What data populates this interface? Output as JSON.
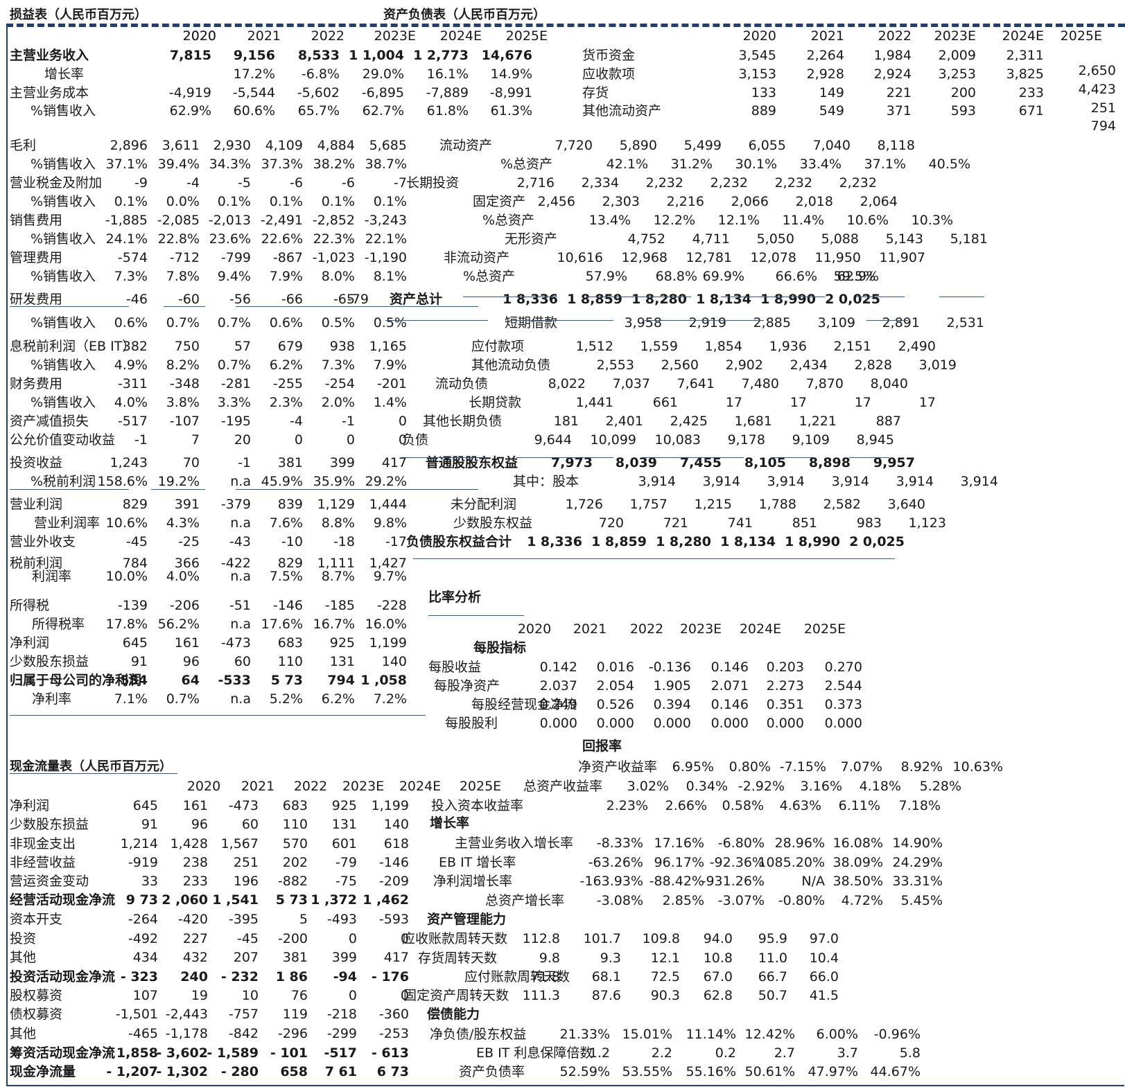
{
  "is": {
    "title": "损益表（人民币百万元）",
    "years": [
      "2020",
      "2021",
      "2022",
      "2023E",
      "2024E",
      "2025E"
    ],
    "rows": [
      {
        "label": "主营业务收入",
        "bold": true,
        "values": [
          "7,815",
          "9,156",
          "8,533",
          "1 1,004",
          "1 2,773",
          "14,676"
        ]
      },
      {
        "label": "增长率",
        "values": [
          "",
          "17.2%",
          "-6.8%",
          "29.0%",
          "16.1%",
          "14.9%"
        ]
      },
      {
        "label": "主营业务成本",
        "values": [
          "-4,919",
          "-5,544",
          "-5,602",
          "-6,895",
          "-7,889",
          "-8,991"
        ]
      },
      {
        "label": "%销售收入",
        "values": [
          "62.9%",
          "60.6%",
          "65.7%",
          "62.7%",
          "61.8%",
          "61.3%"
        ]
      },
      {
        "label": "毛利",
        "values": [
          "2,896",
          "3,611",
          "2,930",
          "4,109",
          "4,884",
          "5,685"
        ]
      },
      {
        "label": "%销售收入",
        "values": [
          "37.1%",
          "39.4%",
          "34.3%",
          "37.3%",
          "38.2%",
          "38.7%"
        ]
      },
      {
        "label": "营业税金及附加",
        "values": [
          "-9",
          "-4",
          "-5",
          "-6",
          "-6",
          "-7"
        ]
      },
      {
        "label": "%销售收入",
        "values": [
          "0.1%",
          "0.0%",
          "0.1%",
          "0.1%",
          "0.1%",
          "0.1%"
        ]
      },
      {
        "label": "销售费用",
        "values": [
          "-1,885",
          "-2,085",
          "-2,013",
          "-2,491",
          "-2,852",
          "-3,243"
        ]
      },
      {
        "label": "%销售收入",
        "values": [
          "24.1%",
          "22.8%",
          "23.6%",
          "22.6%",
          "22.3%",
          "22.1%"
        ]
      },
      {
        "label": "管理费用",
        "values": [
          "-574",
          "-712",
          "-799",
          "-867",
          "-1,023",
          "-1,190"
        ]
      },
      {
        "label": "%销售收入",
        "values": [
          "7.3%",
          "7.8%",
          "9.4%",
          "7.9%",
          "8.0%",
          "8.1%"
        ]
      },
      {
        "label": "研发费用",
        "values": [
          "-46",
          "-60",
          "-56",
          "-66",
          "-65",
          "-79"
        ]
      },
      {
        "label": "%销售收入",
        "values": [
          "0.6%",
          "0.7%",
          "0.7%",
          "0.6%",
          "0.5%",
          "0.5%"
        ]
      },
      {
        "label": "息税前利润（EB IT）",
        "values": [
          "382",
          "750",
          "57",
          "679",
          "938",
          "1,165"
        ]
      },
      {
        "label": "%销售收入",
        "values": [
          "4.9%",
          "8.2%",
          "0.7%",
          "6.2%",
          "7.3%",
          "7.9%"
        ]
      },
      {
        "label": "财务费用",
        "values": [
          "-311",
          "-348",
          "-281",
          "-255",
          "-254",
          "-201"
        ]
      },
      {
        "label": "%销售收入",
        "values": [
          "4.0%",
          "3.8%",
          "3.3%",
          "2.3%",
          "2.0%",
          "1.4%"
        ]
      },
      {
        "label": "资产减值损失",
        "values": [
          "-517",
          "-107",
          "-195",
          "-4",
          "-1",
          "0"
        ]
      },
      {
        "label": "公允价值变动收益",
        "values": [
          "-1",
          "7",
          "20",
          "0",
          "0",
          "0"
        ]
      },
      {
        "label": "投资收益",
        "values": [
          "1,243",
          "70",
          "-1",
          "381",
          "399",
          "417"
        ]
      },
      {
        "label": "%税前利润",
        "values": [
          "158.6%",
          "19.2%",
          "n.a",
          "45.9%",
          "35.9%",
          "29.2%"
        ]
      },
      {
        "label": "营业利润",
        "values": [
          "829",
          "391",
          "-379",
          "839",
          "1,129",
          "1,444"
        ]
      },
      {
        "label": "营业利润率",
        "values": [
          "10.6%",
          "4.3%",
          "n.a",
          "7.6%",
          "8.8%",
          "9.8%"
        ]
      },
      {
        "label": "营业外收支",
        "values": [
          "-45",
          "-25",
          "-43",
          "-10",
          "-18",
          "-17"
        ]
      },
      {
        "label": "税前利润",
        "values": [
          "784",
          "366",
          "-422",
          "829",
          "1,111",
          "1,427"
        ]
      },
      {
        "label": "利润率",
        "values": [
          "10.0%",
          "4.0%",
          "n.a",
          "7.5%",
          "8.7%",
          "9.7%"
        ]
      },
      {
        "label": "所得税",
        "values": [
          "-139",
          "-206",
          "-51",
          "-146",
          "-185",
          "-228"
        ]
      },
      {
        "label": "所得税率",
        "values": [
          "17.8%",
          "56.2%",
          "n.a",
          "17.6%",
          "16.7%",
          "16.0%"
        ]
      },
      {
        "label": "净利润",
        "values": [
          "645",
          "161",
          "-473",
          "683",
          "925",
          "1,199"
        ]
      },
      {
        "label": "少数股东损益",
        "values": [
          "91",
          "96",
          "60",
          "110",
          "131",
          "140"
        ]
      },
      {
        "label": "归属于母公司的净利润",
        "bold": true,
        "values": [
          "554",
          "64",
          "-533",
          "5 73",
          "794",
          "1 ,058"
        ]
      },
      {
        "label": "净利率",
        "values": [
          "7.1%",
          "0.7%",
          "n.a",
          "5.2%",
          "6.2%",
          "7.2%"
        ]
      }
    ]
  },
  "bs": {
    "title": "资产负债表（人民币百万元）",
    "years": [
      "2020",
      "2021",
      "2022",
      "2023E",
      "2024E",
      "2025E"
    ],
    "rows": [
      {
        "label": "货币资金",
        "values": [
          "3,545",
          "2,264",
          "1,984",
          "2,009",
          "2,311",
          "2,650"
        ]
      },
      {
        "label": "应收款项",
        "values": [
          "3,153",
          "2,928",
          "2,924",
          "3,253",
          "3,825",
          "4,423"
        ]
      },
      {
        "label": "存货",
        "values": [
          "133",
          "149",
          "221",
          "200",
          "233",
          "251"
        ]
      },
      {
        "label": "其他流动资产",
        "values": [
          "889",
          "549",
          "371",
          "593",
          "671",
          "794"
        ]
      },
      {
        "label": "流动资产",
        "values": [
          "7,720",
          "5,890",
          "5,499",
          "6,055",
          "7,040",
          "8,118"
        ]
      },
      {
        "label": "%总资产",
        "values": [
          "42.1%",
          "31.2%",
          "30.1%",
          "33.4%",
          "37.1%",
          "40.5%"
        ]
      },
      {
        "label": "长期投资",
        "values": [
          "2,716",
          "2,334",
          "2,232",
          "2,232",
          "2,232",
          "2,232"
        ]
      },
      {
        "label": "固定资产",
        "values": [
          "2,456",
          "2,303",
          "2,216",
          "2,066",
          "2,018",
          "2,064"
        ]
      },
      {
        "label": "%总资产",
        "values": [
          "13.4%",
          "12.2%",
          "12.1%",
          "11.4%",
          "10.6%",
          "10.3%"
        ]
      },
      {
        "label": "无形资产",
        "values": [
          "4,752",
          "4,711",
          "5,050",
          "5,088",
          "5,143",
          "5,181"
        ]
      },
      {
        "label": "非流动资产",
        "values": [
          "10,616",
          "12,968",
          "12,781",
          "12,078",
          "11,950",
          "11,907"
        ]
      },
      {
        "label": "%总资产",
        "values": [
          "57.9%",
          "68.8%",
          "69.9%",
          "66.6%",
          "62.9%",
          "59.5%"
        ]
      },
      {
        "label": "资产总计",
        "bold": true,
        "values": [
          "1 8,336",
          "1 8,859",
          "1 8,280",
          "1 8,134",
          "1 8,990",
          "2 0,025"
        ]
      },
      {
        "label": "短期借款",
        "values": [
          "3,958",
          "2,919",
          "2,885",
          "3,109",
          "2,891",
          "2,531"
        ]
      },
      {
        "label": "应付款项",
        "values": [
          "1,512",
          "1,559",
          "1,854",
          "1,936",
          "2,151",
          "2,490"
        ]
      },
      {
        "label": "其他流动负债",
        "values": [
          "2,553",
          "2,560",
          "2,902",
          "2,434",
          "2,828",
          "3,019"
        ]
      },
      {
        "label": "流动负债",
        "values": [
          "8,022",
          "7,037",
          "7,641",
          "7,480",
          "7,870",
          "8,040"
        ]
      },
      {
        "label": "长期贷款",
        "values": [
          "1,441",
          "661",
          "17",
          "17",
          "17",
          "17"
        ]
      },
      {
        "label": "其他长期负债",
        "values": [
          "181",
          "2,401",
          "2,425",
          "1,681",
          "1,221",
          "887"
        ]
      },
      {
        "label": "负债",
        "values": [
          "9,644",
          "10,099",
          "10,083",
          "9,178",
          "9,109",
          "8,945"
        ]
      },
      {
        "label": "普通股股东权益",
        "bold": true,
        "values": [
          "7,973",
          "8,039",
          "7,455",
          "8,105",
          "8,898",
          "9,957"
        ]
      },
      {
        "label": "其中：股本",
        "values": [
          "3,914",
          "3,914",
          "3,914",
          "3,914",
          "3,914",
          "3,914"
        ]
      },
      {
        "label": "未分配利润",
        "values": [
          "1,726",
          "1,757",
          "1,215",
          "1,788",
          "2,582",
          "3,640"
        ]
      },
      {
        "label": "少数股东权益",
        "values": [
          "720",
          "721",
          "741",
          "851",
          "983",
          "1,123"
        ]
      },
      {
        "label": "负债股东权益合计",
        "bold": true,
        "values": [
          "1 8,336",
          "1 8,859",
          "1 8,280",
          "1 8,134",
          "1 8,990",
          "2 0,025"
        ]
      }
    ]
  },
  "ratio": {
    "title": "比率分析",
    "years": [
      "2020",
      "2021",
      "2022",
      "2023E",
      "2024E",
      "2025E"
    ],
    "sections": [
      {
        "title": "每股指标",
        "rows": [
          {
            "label": "每股收益",
            "values": [
              "0.142",
              "0.016",
              "-0.136",
              "0.146",
              "0.203",
              "0.270"
            ]
          },
          {
            "label": "每股净资产",
            "values": [
              "2.037",
              "2.054",
              "1.905",
              "2.071",
              "2.273",
              "2.544"
            ]
          },
          {
            "label": "每股经营现金净流",
            "values": [
              "0.249",
              "0.526",
              "0.394",
              "0.146",
              "0.351",
              "0.373"
            ]
          },
          {
            "label": "每股股利",
            "values": [
              "0.000",
              "0.000",
              "0.000",
              "0.000",
              "0.000",
              "0.000"
            ]
          }
        ]
      },
      {
        "title": "回报率",
        "rows": [
          {
            "label": "净资产收益率",
            "values": [
              "6.95%",
              "0.80%",
              "-7.15%",
              "7.07%",
              "8.92%",
              "10.63%"
            ]
          },
          {
            "label": "总资产收益率",
            "values": [
              "3.02%",
              "0.34%",
              "-2.92%",
              "3.16%",
              "4.18%",
              "5.28%"
            ]
          },
          {
            "label": "投入资本收益率",
            "values": [
              "2.23%",
              "2.66%",
              "0.58%",
              "4.63%",
              "6.11%",
              "7.18%"
            ]
          }
        ]
      },
      {
        "title": "增长率",
        "rows": [
          {
            "label": "主营业务收入增长率",
            "values": [
              "-8.33%",
              "17.16%",
              "-6.80%",
              "28.96%",
              "16.08%",
              "14.90%"
            ]
          },
          {
            "label": "EB IT 增长率",
            "values": [
              "-63.26%",
              "96.17%",
              "-92.36%",
              "1085.20%",
              "38.09%",
              "24.29%"
            ]
          },
          {
            "label": "净利润增长率",
            "values": [
              "-163.93%",
              "-88.42%",
              "-931.26%",
              "N/A",
              "38.50%",
              "33.31%"
            ]
          },
          {
            "label": "总资产增长率",
            "values": [
              "-3.08%",
              "2.85%",
              "-3.07%",
              "-0.80%",
              "4.72%",
              "5.45%"
            ]
          }
        ]
      },
      {
        "title": "资产管理能力",
        "rows": [
          {
            "label": "应收账款周转天数",
            "values": [
              "112.8",
              "101.7",
              "109.8",
              "94.0",
              "95.9",
              "97.0"
            ]
          },
          {
            "label": "存货周转天数",
            "values": [
              "9.8",
              "9.3",
              "12.1",
              "10.8",
              "11.0",
              "10.4"
            ]
          },
          {
            "label": "应付账款周转天数",
            "values": [
              "71.8",
              "68.1",
              "72.5",
              "67.0",
              "66.7",
              "66.0"
            ]
          },
          {
            "label": "固定资产周转天数",
            "values": [
              "111.3",
              "87.6",
              "90.3",
              "62.8",
              "50.7",
              "41.5"
            ]
          }
        ]
      },
      {
        "title": "偿债能力",
        "rows": [
          {
            "label": "净负债/股东权益",
            "values": [
              "21.33%",
              "15.01%",
              "11.14%",
              "12.42%",
              "6.00%",
              "-0.96%"
            ]
          },
          {
            "label": "EB IT 利息保障倍数",
            "values": [
              "1.2",
              "2.2",
              "0.2",
              "2.7",
              "3.7",
              "5.8"
            ]
          },
          {
            "label": "资产负债率",
            "values": [
              "52.59%",
              "53.55%",
              "55.16%",
              "50.61%",
              "47.97%",
              "44.67%"
            ]
          }
        ]
      }
    ]
  },
  "cf": {
    "title": "现金流量表（人民币百万元）",
    "years": [
      "2020",
      "2021",
      "2022",
      "2023E",
      "2024E",
      "2025E"
    ],
    "rows": [
      {
        "label": "净利润",
        "values": [
          "645",
          "161",
          "-473",
          "683",
          "925",
          "1,199"
        ]
      },
      {
        "label": "少数股东损益",
        "values": [
          "91",
          "96",
          "60",
          "110",
          "131",
          "140"
        ]
      },
      {
        "label": "非现金支出",
        "values": [
          "1,214",
          "1,428",
          "1,567",
          "570",
          "601",
          "618"
        ]
      },
      {
        "label": "非经营收益",
        "values": [
          "-919",
          "238",
          "251",
          "202",
          "-79",
          "-146"
        ]
      },
      {
        "label": "营运资金变动",
        "values": [
          "33",
          "233",
          "196",
          "-882",
          "-75",
          "-209"
        ]
      },
      {
        "label": "经营活动现金净流",
        "bold": true,
        "values": [
          "9 73",
          "2 ,060",
          "1 ,541",
          "5 73",
          "1 ,372",
          "1 ,462"
        ]
      },
      {
        "label": "资本开支",
        "values": [
          "-264",
          "-420",
          "-395",
          "5",
          "-493",
          "-593"
        ]
      },
      {
        "label": "投资",
        "values": [
          "-492",
          "227",
          "-45",
          "-200",
          "0",
          "0"
        ]
      },
      {
        "label": "其他",
        "values": [
          "434",
          "432",
          "207",
          "381",
          "399",
          "417"
        ]
      },
      {
        "label": "投资活动现金净流",
        "bold": true,
        "values": [
          "- 323",
          "240",
          "- 232",
          "1 86",
          "-94",
          "- 176"
        ]
      },
      {
        "label": "股权募资",
        "values": [
          "107",
          "19",
          "10",
          "76",
          "0",
          "0"
        ]
      },
      {
        "label": "债权募资",
        "values": [
          "-1,501",
          "-2,443",
          "-757",
          "119",
          "-218",
          "-360"
        ]
      },
      {
        "label": "其他",
        "values": [
          "-465",
          "-1,178",
          "-842",
          "-296",
          "-299",
          "-253"
        ]
      },
      {
        "label": "筹资活动现金净流",
        "bold": true,
        "values": [
          "- 1,858",
          "- 3,602",
          "- 1,589",
          "- 101",
          "-517",
          "- 613"
        ]
      },
      {
        "label": "现金净流量",
        "bold": true,
        "values": [
          "- 1,207",
          "- 1,302",
          "- 280",
          "658",
          "7 61",
          "6 73"
        ]
      }
    ]
  }
}
